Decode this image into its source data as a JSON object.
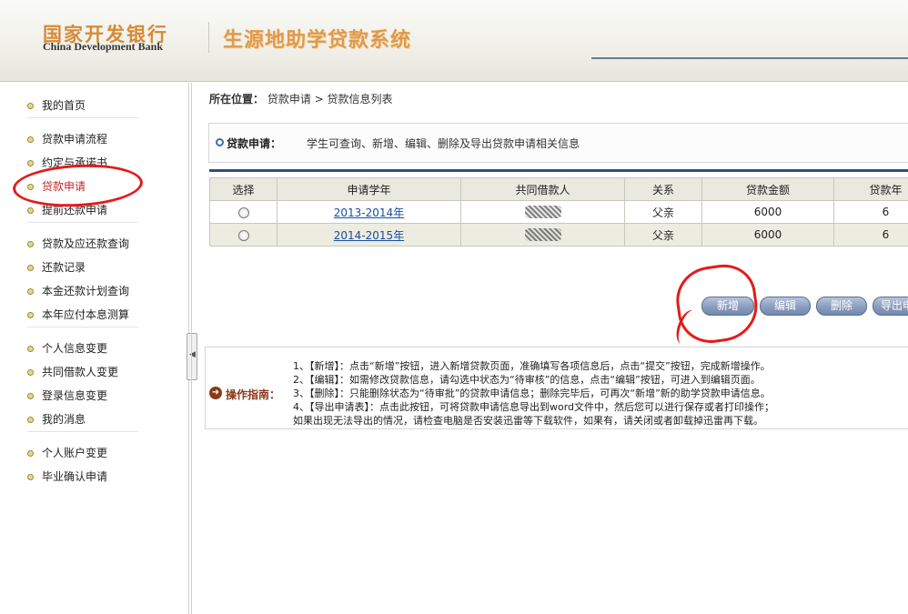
{
  "header": {
    "logo_cn": "国家开发银行",
    "logo_en": "China Development Bank",
    "system_title": "生源地助学贷款系统"
  },
  "sidebar": {
    "groups": [
      [
        "我的首页"
      ],
      [
        "贷款申请流程",
        "约定与承诺书",
        "贷款申请",
        "提前还款申请"
      ],
      [
        "贷款及应还款查询",
        "还款记录",
        "本金还款计划查询",
        "本年应付本息测算"
      ],
      [
        "个人信息变更",
        "共同借款人变更",
        "登录信息变更",
        "我的消息"
      ],
      [
        "个人账户变更",
        "毕业确认申请"
      ]
    ],
    "active": "贷款申请"
  },
  "breadcrumb": {
    "label": "所在位置：",
    "path": "贷款申请 > 贷款信息列表"
  },
  "section": {
    "title": "贷款申请：",
    "description": "学生可查询、新增、编辑、删除及导出贷款申请相关信息"
  },
  "table": {
    "columns": [
      "选择",
      "申请学年",
      "共同借款人",
      "关系",
      "贷款金额",
      "贷款年"
    ],
    "rows": [
      {
        "year": "2013-2014年",
        "relation": "父亲",
        "amount": "6000",
        "term": "6"
      },
      {
        "year": "2014-2015年",
        "relation": "父亲",
        "amount": "6000",
        "term": "6"
      }
    ]
  },
  "buttons": {
    "add": "新增",
    "edit": "编辑",
    "delete": "删除",
    "export": "导出申"
  },
  "guide": {
    "label": "操作指南：",
    "lines": [
      "1、【新增】：点击“新增”按钮，进入新增贷款页面，准确填写各项信息后，点击“提交”按钮，完成新增操作。",
      "2、【编辑】：如需修改贷款信息，请勾选中状态为“待审核”的信息，点击“编辑”按钮，可进入到编辑页面。",
      "3、【删除】：只能删除状态为“待审批”的贷款申请信息；删除完毕后，可再次“新增”新的助学贷款申请信息。",
      "4、【导出申请表】：点击此按钮，可将贷款申请信息导出到word文件中，然后您可以进行保存或者打印操作；",
      "    如果出现无法导出的情况，请检查电脑是否安装迅雷等下载软件，如果有，请关闭或者卸载掉迅雷再下载。"
    ]
  },
  "colors": {
    "accent_orange": "#e09a4a",
    "highlight_red": "#e31b1b",
    "active_nav": "#c62828",
    "button_blue": "#8a9dbe"
  }
}
